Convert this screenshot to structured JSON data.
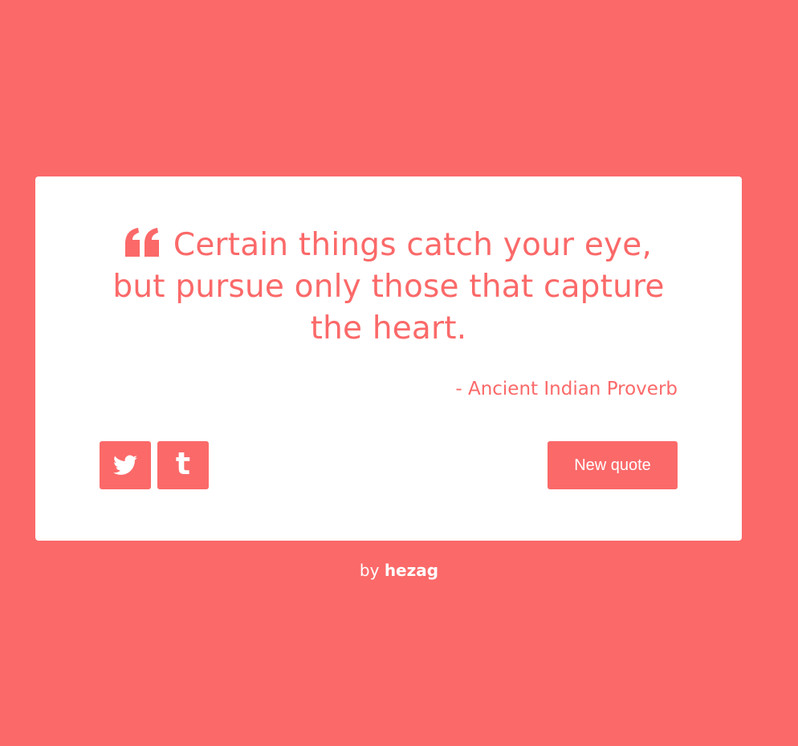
{
  "theme": {
    "accent": "#fb6969",
    "background": "#fb6969",
    "card": "#ffffff",
    "button_text": "#ffffff"
  },
  "quote": {
    "icon": "quote-left-icon",
    "text": "Certain things catch your eye, but pursue only those that capture the heart.",
    "author": "- Ancient Indian Proverb"
  },
  "actions": {
    "twitter_icon": "twitter-icon",
    "tumblr_icon": "tumblr-icon",
    "tumblr_glyph": "t",
    "new_quote_label": "New quote"
  },
  "footer": {
    "prefix": "by",
    "author": "hezag"
  }
}
